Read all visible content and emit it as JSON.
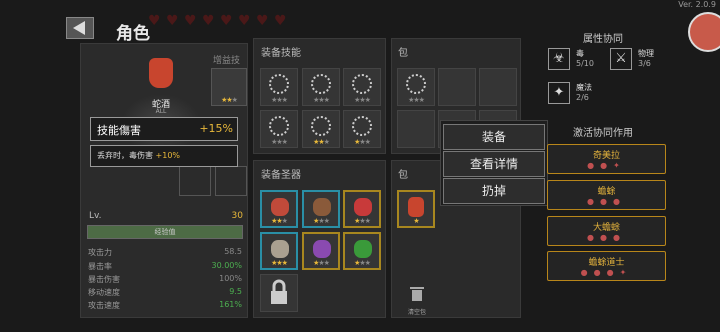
{
  "header": {
    "title": "角色",
    "version": "Ver. 2.0.9"
  },
  "hearts_count": 8,
  "character": {
    "item_name": "蛇酒",
    "item_tag": "ALL",
    "label_weapon_skill": "增益技能",
    "level_label": "Lv.",
    "level_value": "30",
    "bar_label": "经验值"
  },
  "tooltip": {
    "title": "技能傷害",
    "value": "+15%",
    "desc_prefix": "丢弃时，毒伤害 ",
    "desc_value": "+10%"
  },
  "stats": [
    {
      "label": "攻击力",
      "value": "58.5",
      "color": "#888888"
    },
    {
      "label": "暴击率",
      "value": "30.00%",
      "color": "#4caf50"
    },
    {
      "label": "暴击伤害",
      "value": "100%",
      "color": "#888888"
    },
    {
      "label": "移动速度",
      "value": "9.5",
      "color": "#4caf50"
    },
    {
      "label": "攻击速度",
      "value": "161%",
      "color": "#4caf50"
    }
  ],
  "equip_skills": {
    "title": "装备技能"
  },
  "bag_top": {
    "title": "包"
  },
  "equip_items": {
    "title": "装备圣器"
  },
  "bag_bottom": {
    "title": "包"
  },
  "clear_bag": "清空包",
  "context_menu": {
    "equip": "装备",
    "details": "查看详情",
    "discard": "扔掉"
  },
  "attributes": {
    "title": "属性协同",
    "items": [
      {
        "name": "毒",
        "count": "5/10"
      },
      {
        "name": "物理",
        "count": "3/6"
      },
      {
        "name": "魔法",
        "count": "2/6"
      }
    ]
  },
  "synergies": {
    "title": "激活协同作用",
    "items": [
      {
        "name": "奇美拉"
      },
      {
        "name": "蟾蜍"
      },
      {
        "name": "大蟾蜍"
      },
      {
        "name": "蟾蜍道士"
      }
    ]
  },
  "colors": {
    "gold": "#e8b83a",
    "green": "#4caf50",
    "cyan": "#2a8fa6",
    "accent_border": "#b8861a"
  }
}
